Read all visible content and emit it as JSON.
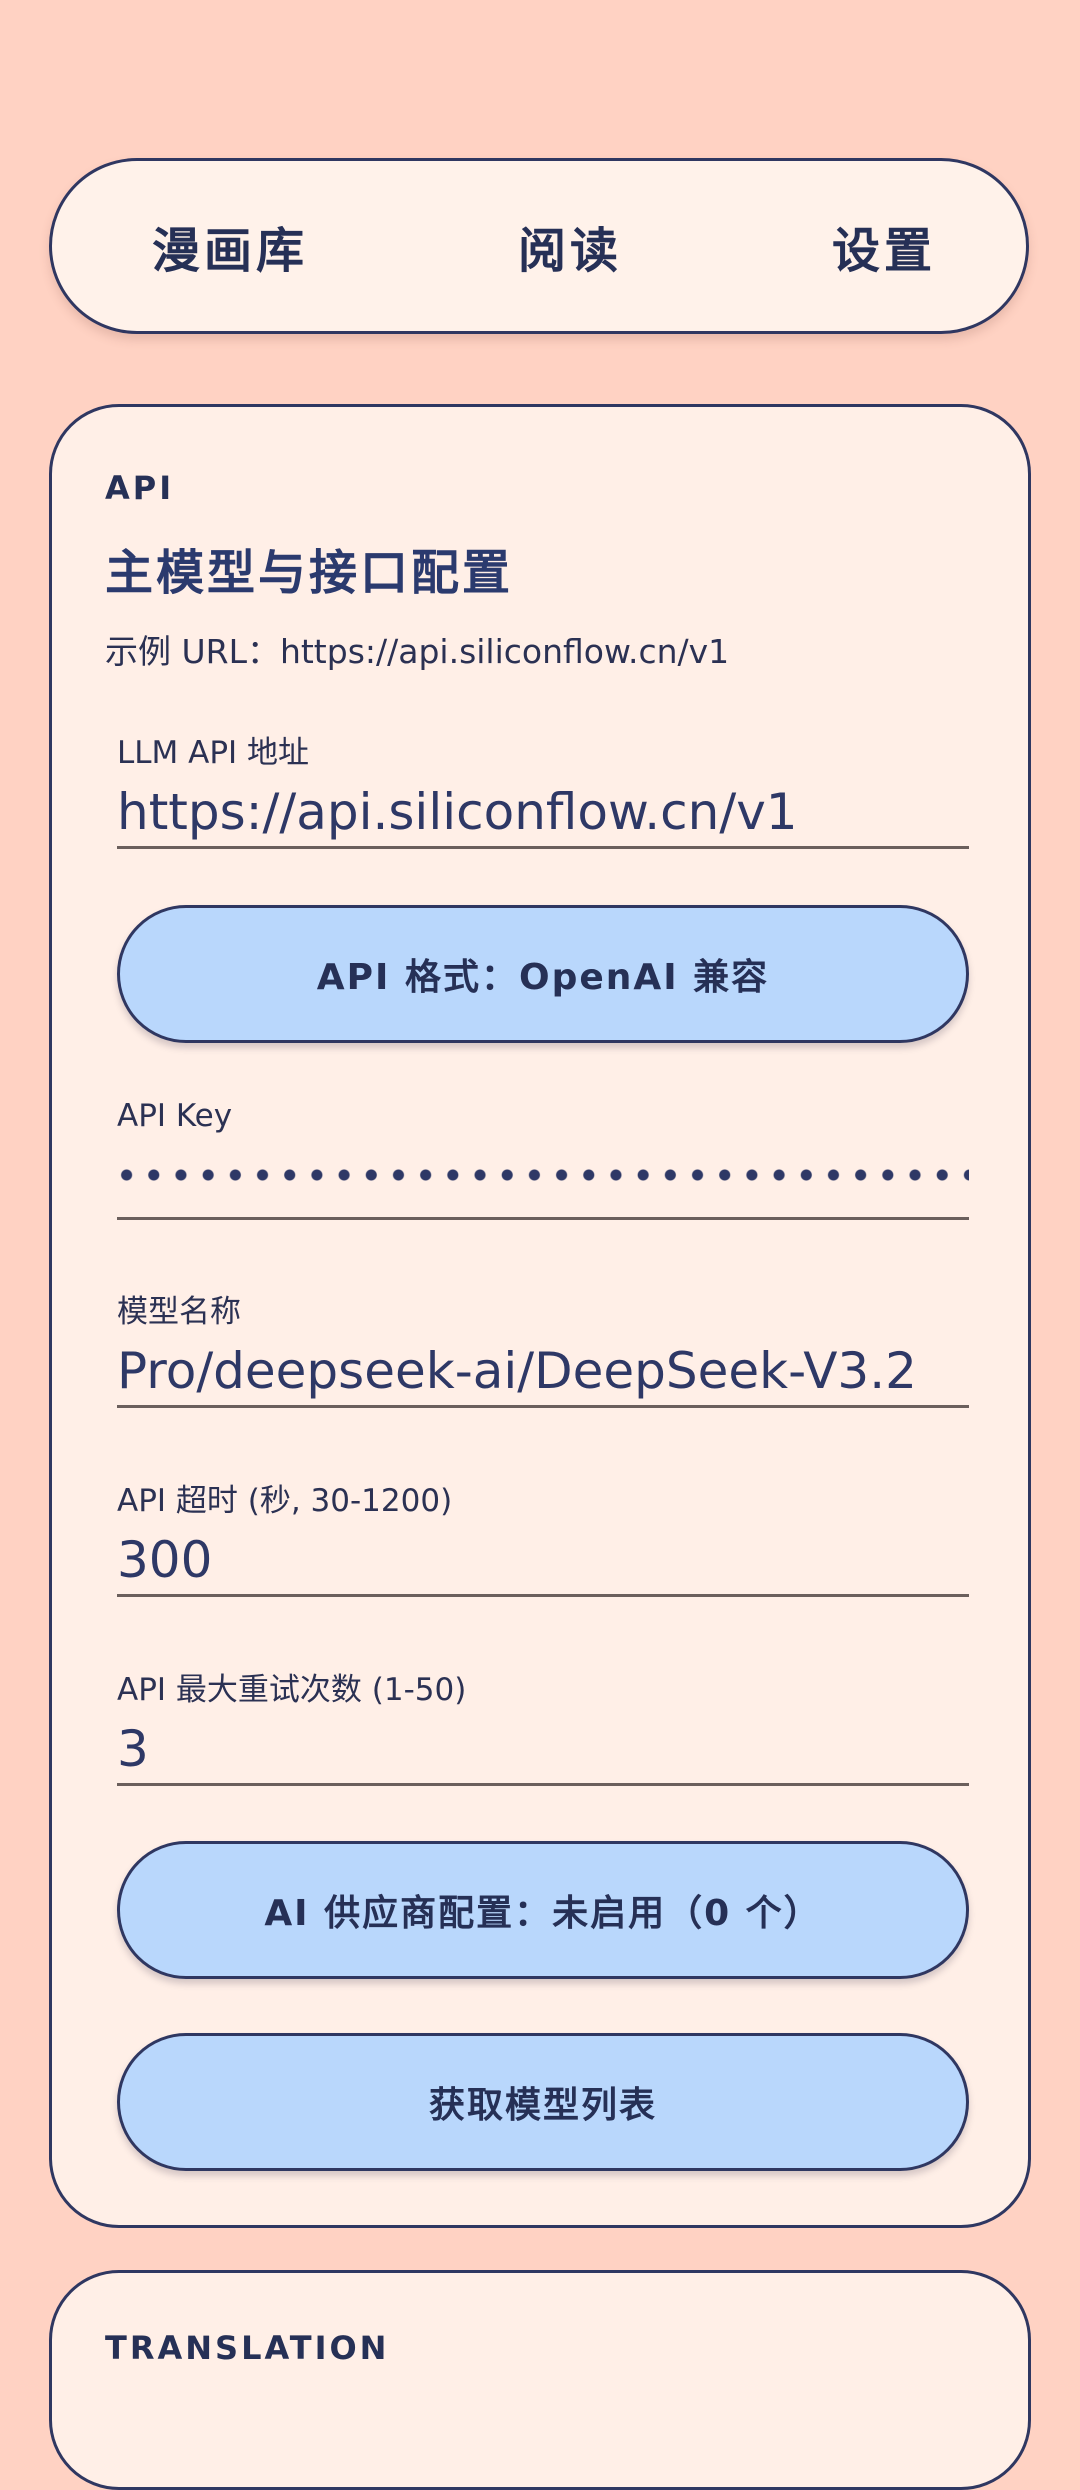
{
  "nav": {
    "tabs": [
      "漫画库",
      "阅读",
      "设置"
    ]
  },
  "api_card": {
    "section_tag": "API",
    "title": "主模型与接口配置",
    "example_url": "示例 URL：https://api.siliconflow.cn/v1",
    "llm_api_url": {
      "label": "LLM API 地址",
      "value": "https://api.siliconflow.cn/v1"
    },
    "api_format_button": "API 格式：OpenAI 兼容",
    "api_key": {
      "label": "API Key"
    },
    "model_name": {
      "label": "模型名称",
      "value": "Pro/deepseek-ai/DeepSeek-V3.2"
    },
    "timeout": {
      "label": "API 超时 (秒, 30-1200)",
      "value": "300"
    },
    "max_retries": {
      "label": "API 最大重试次数 (1-50)",
      "value": "3"
    },
    "provider_button": "AI 供应商配置：未启用（0 个）",
    "fetch_models_button": "获取模型列表"
  },
  "translation_card": {
    "section_tag": "TRANSLATION"
  },
  "colors": {
    "background": "#ffd2c3",
    "card": "#ffefe7",
    "button": "#b9d7fc",
    "text": "#263056",
    "border": "#2f3761"
  }
}
